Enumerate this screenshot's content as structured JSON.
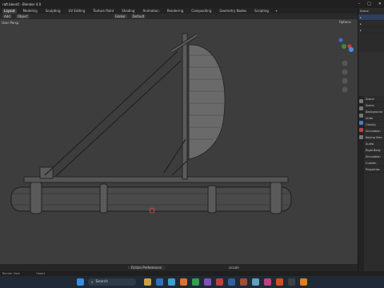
{
  "window": {
    "title": "raft.blend] - Blender 4.0",
    "controls": [
      "–",
      "□",
      "✕"
    ]
  },
  "workspaces": [
    {
      "label": "Layout",
      "active": true
    },
    {
      "label": "Modeling",
      "active": false
    },
    {
      "label": "Sculpting",
      "active": false
    },
    {
      "label": "UV Editing",
      "active": false
    },
    {
      "label": "Texture Paint",
      "active": false
    },
    {
      "label": "Shading",
      "active": false
    },
    {
      "label": "Animation",
      "active": false
    },
    {
      "label": "Rendering",
      "active": false
    },
    {
      "label": "Compositing",
      "active": false
    },
    {
      "label": "Geometry Nodes",
      "active": false
    },
    {
      "label": "Scripting",
      "active": false
    }
  ],
  "scene": {
    "label": "Scene"
  },
  "toolbar": {
    "mode": "Add",
    "object": "Object",
    "orientation": "Global",
    "pivot": "Default"
  },
  "viewport": {
    "header_text": "User Persp",
    "options_label": "Options"
  },
  "timeline": {
    "preferences_label": "Fiction Preferences",
    "search_text": "cicode"
  },
  "status": {
    "left": "Render View",
    "right": "Object"
  },
  "properties": {
    "header": "Scene",
    "rows": [
      "Scene",
      "Background",
      "Units",
      "Gravity",
      "Simulation",
      "Keying Sets",
      "Audio",
      "Rigid Body",
      "Simulation",
      "Custom",
      "Properties"
    ]
  },
  "taskbar": {
    "search_placeholder": "Search"
  }
}
